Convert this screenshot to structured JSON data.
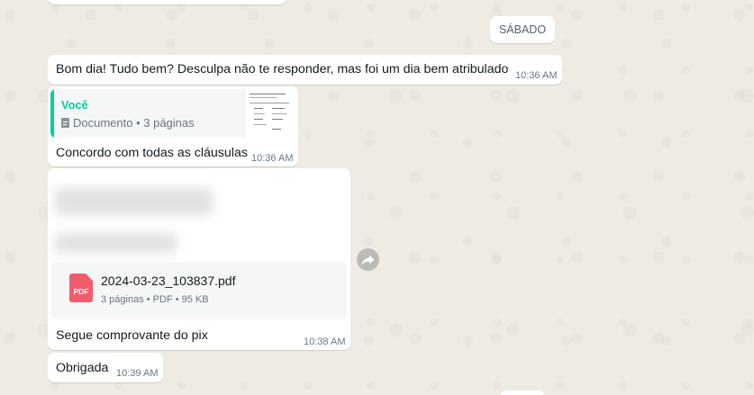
{
  "date_chip": "SÁBADO",
  "messages": {
    "m1": {
      "text": "Bom dia! Tudo bem? Desculpa não te responder, mas foi um dia bem atribulado",
      "time": "10:36 AM"
    },
    "m2": {
      "quote_author": "Você",
      "quote_doc": "Documento • 3 páginas",
      "text": "Concordo com todas as cláusulas",
      "time": "10:36 AM"
    },
    "m3": {
      "file_icon_label": "PDF",
      "file_name": "2024-03-23_103837.pdf",
      "file_meta": "3 páginas • PDF • 95 KB",
      "text": "Segue comprovante do pix",
      "time": "10:38 AM"
    },
    "m4": {
      "text": "Obrigada",
      "time": "10:39 AM"
    }
  },
  "icons": {
    "quote_doc": "document-icon",
    "file": "pdf-icon",
    "forward": "forward-icon"
  },
  "colors": {
    "background": "#efeae2",
    "bubble": "#ffffff",
    "quote_accent": "#06cf9c",
    "pdf_red": "#f15c6d",
    "meta_grey": "#667781"
  }
}
